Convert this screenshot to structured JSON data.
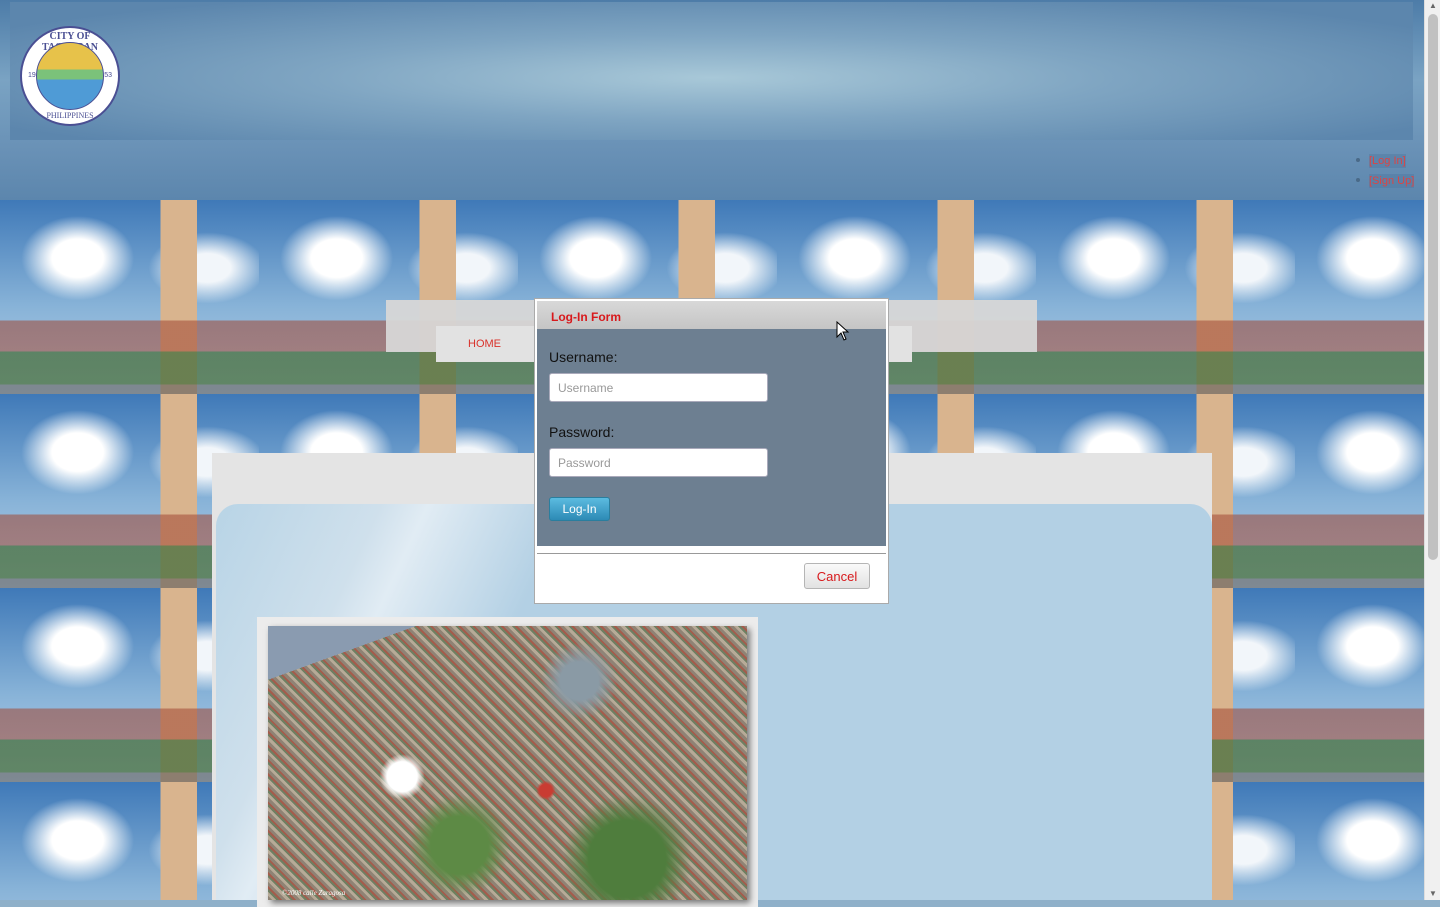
{
  "header": {
    "logo": {
      "top_text": "CITY OF TACLOBAN",
      "bottom_text": "PHILIPPINES",
      "year_left": "19",
      "year_right": "53"
    },
    "auth_links": [
      {
        "label": "[Log In]"
      },
      {
        "label": "[Sign Up]"
      }
    ]
  },
  "nav": {
    "home_label": "HOME"
  },
  "modal": {
    "title": "Log-In Form",
    "username_label": "Username:",
    "username_placeholder": "Username",
    "password_label": "Password:",
    "password_placeholder": "Password",
    "login_button": "Log-In",
    "cancel_button": "Cancel"
  },
  "photo": {
    "credit": "©2008 calle Zaragosa"
  },
  "colors": {
    "accent_red": "#d8191c",
    "modal_body": "#6d7f91",
    "login_button": "#2d8ab5"
  }
}
